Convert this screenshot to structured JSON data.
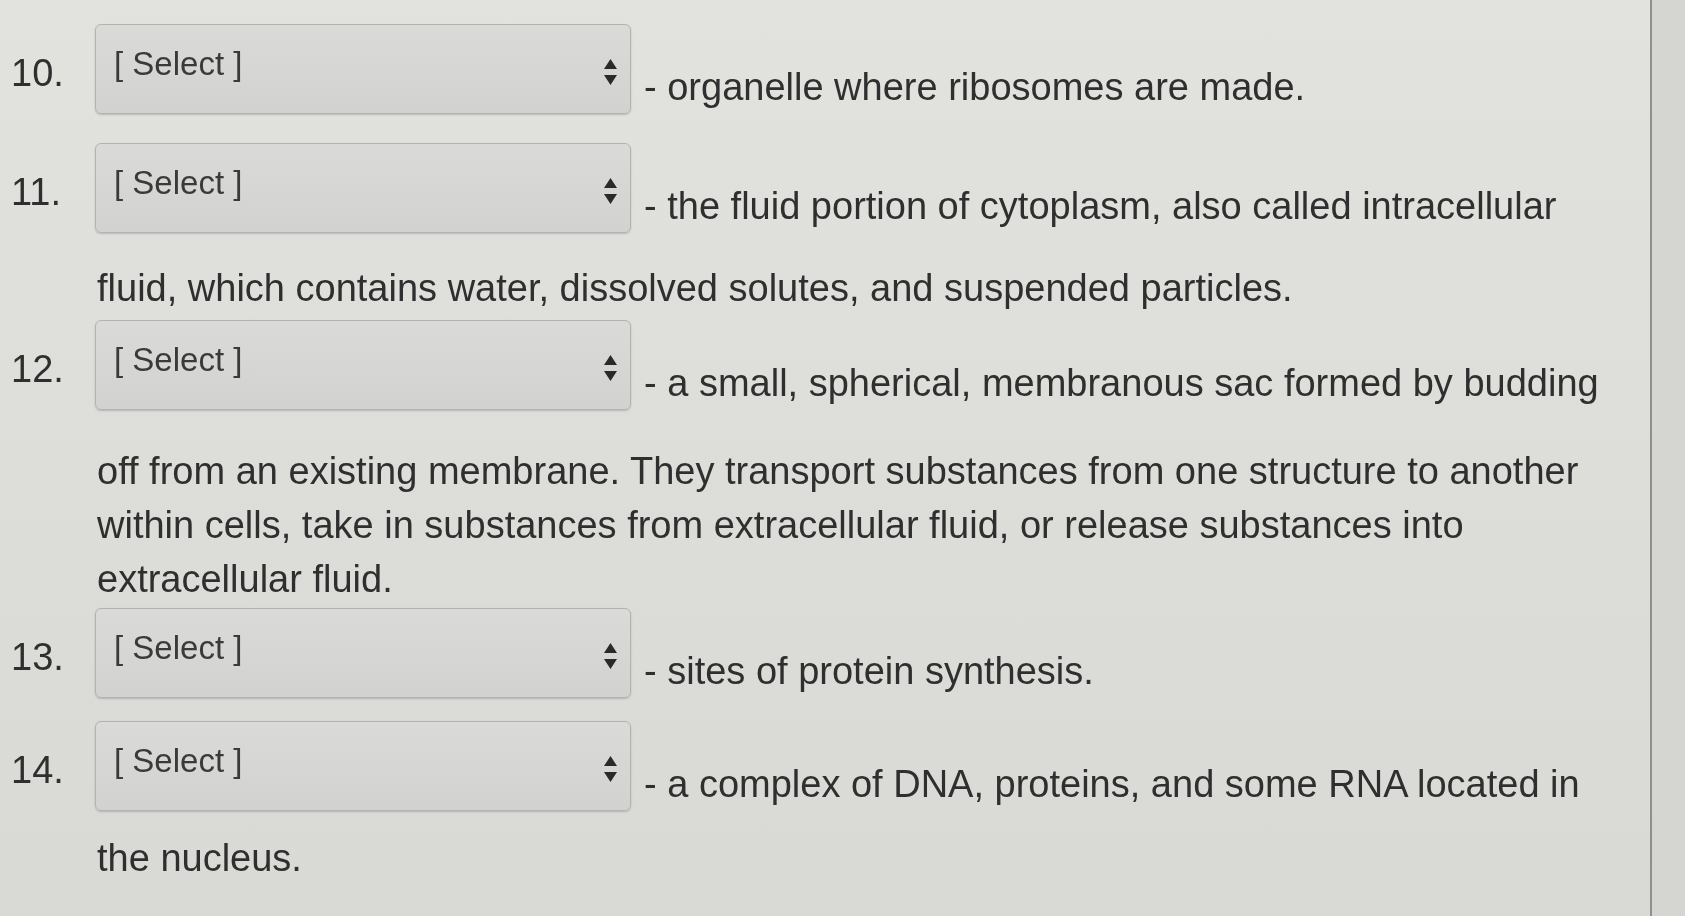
{
  "questions": [
    {
      "number": "10.",
      "dropdown": {
        "value": "[ Select ]"
      },
      "description": "- organelle where ribosomes are made."
    },
    {
      "number": "11.",
      "dropdown": {
        "value": "[ Select ]"
      },
      "description": "- the fluid portion of cytoplasm, also called intracellular",
      "description_continued": "fluid, which contains water, dissolved solutes, and suspended particles."
    },
    {
      "number": "12.",
      "dropdown": {
        "value": "[ Select ]"
      },
      "description": "- a small, spherical, membranous sac formed by budding",
      "description_continued": "off from an existing membrane. They transport substances from one structure to another within cells, take in substances from extracellular fluid, or release substances into extracellular fluid."
    },
    {
      "number": "13.",
      "dropdown": {
        "value": "[ Select ]"
      },
      "description": "- sites of protein synthesis."
    },
    {
      "number": "14.",
      "dropdown": {
        "value": "[ Select ]"
      },
      "description": "- a complex of DNA, proteins, and some RNA located in",
      "description_continued": "the nucleus."
    }
  ]
}
